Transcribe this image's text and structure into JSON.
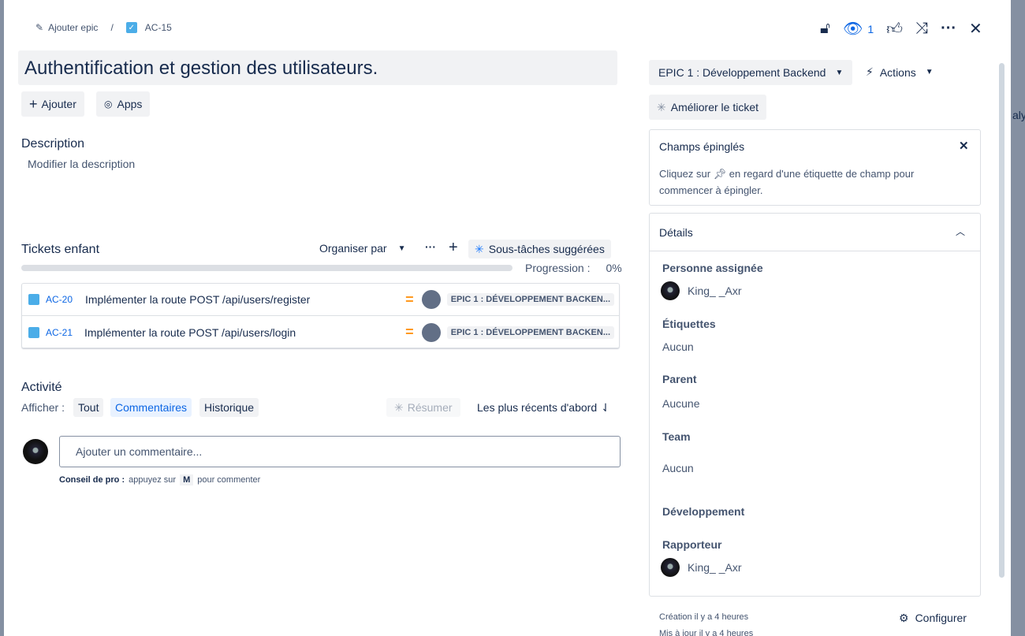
{
  "breadcrumb": {
    "add_epic": "Ajouter epic",
    "separator": "/",
    "issue_key": "AC-15"
  },
  "header": {
    "watch_count": "1"
  },
  "title": "Authentification et gestion des utilisateurs.",
  "toolbar": {
    "add": "Ajouter",
    "apps": "Apps"
  },
  "description": {
    "heading": "Description",
    "placeholder": "Modifier la description"
  },
  "children": {
    "heading": "Tickets enfant",
    "organize": "Organiser par",
    "suggested": "Sous-tâches suggérées",
    "progress_label": "Progression :",
    "progress_value": "0%",
    "progress_fraction": 0,
    "items": [
      {
        "key": "AC-20",
        "summary": "Implémenter la route POST /api/users/register",
        "parent": "EPIC 1 : DÉVELOPPEMENT BACKEN..."
      },
      {
        "key": "AC-21",
        "summary": "Implémenter la route POST /api/users/login",
        "parent": "EPIC 1 : DÉVELOPPEMENT BACKEN..."
      }
    ]
  },
  "activity": {
    "heading": "Activité",
    "show_label": "Afficher :",
    "filters": [
      "Tout",
      "Commentaires",
      "Historique"
    ],
    "summarize": "Résumer",
    "sort": "Les plus récents d'abord",
    "comment_placeholder": "Ajouter un commentaire...",
    "tip_bold": "Conseil de pro :",
    "tip_pre": "appuyez sur",
    "tip_key": "M",
    "tip_post": "pour commenter"
  },
  "side": {
    "epic": "EPIC 1 : Développement Backend",
    "actions": "Actions",
    "improve": "Améliorer le ticket",
    "pinned": {
      "title": "Champs épinglés",
      "text_pre": "Cliquez sur",
      "text_post": "en regard d'une étiquette de champ pour commencer à épingler."
    },
    "details": {
      "title": "Détails",
      "assignee_label": "Personne assignée",
      "assignee": "King_ _Axr",
      "labels_label": "Étiquettes",
      "labels": "Aucun",
      "parent_label": "Parent",
      "parent": "Aucune",
      "team_label": "Team",
      "team": "Aucun",
      "dev_label": "Développement",
      "reporter_label": "Rapporteur",
      "reporter": "King_ _Axr"
    },
    "created": "Création il y a 4 heures",
    "updated": "Mis à jour il y a 4 heures",
    "configure": "Configurer"
  },
  "backdrop": {
    "partial_text": "aly"
  }
}
